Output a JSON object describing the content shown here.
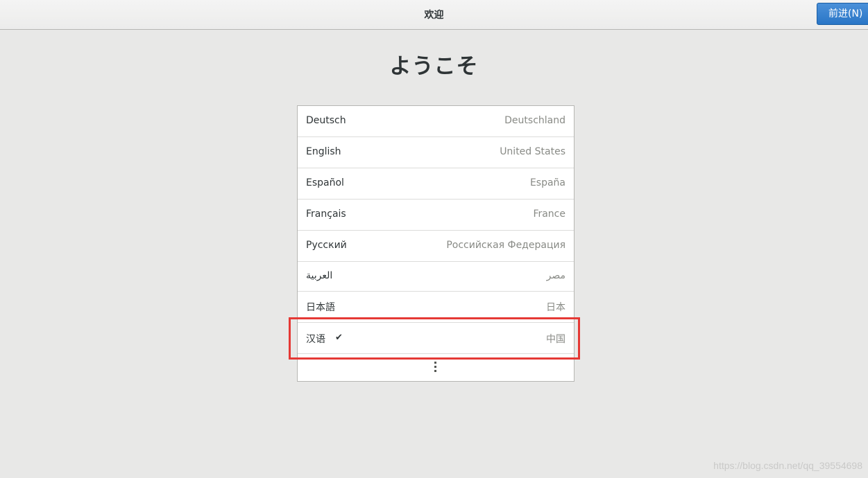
{
  "header": {
    "title": "欢迎",
    "next_button_label": "前进(N)"
  },
  "page": {
    "title": "ようこそ"
  },
  "languages": [
    {
      "name": "Deutsch",
      "region": "Deutschland"
    },
    {
      "name": "English",
      "region": "United States"
    },
    {
      "name": "Español",
      "region": "España"
    },
    {
      "name": "Français",
      "region": "France"
    },
    {
      "name": "Русский",
      "region": "Российская Федерация"
    },
    {
      "name": "العربية",
      "region": "مصر"
    },
    {
      "name": "日本語",
      "region": "日本"
    },
    {
      "name": "汉语",
      "region": "中国",
      "selected": true,
      "check_icon": "✔"
    }
  ],
  "more_icon": "vertical-ellipsis-icon",
  "highlight_color": "#e53935",
  "accent_color": "#2a76c6",
  "watermark": "https://blog.csdn.net/qq_39554698"
}
